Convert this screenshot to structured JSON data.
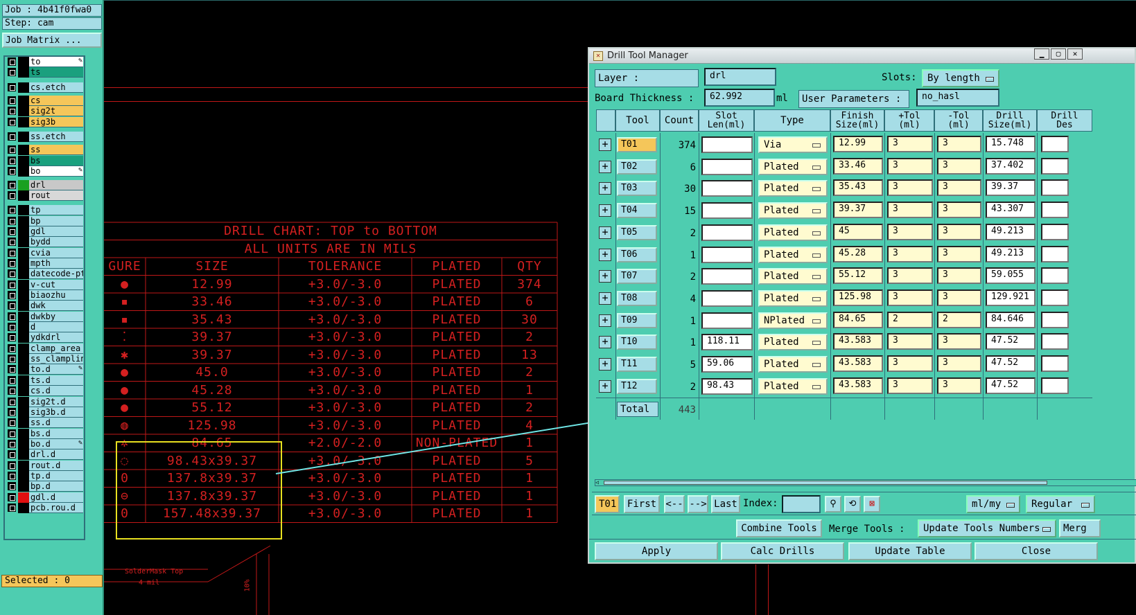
{
  "left_panel": {
    "job": "Job : 4b41f0fwa0",
    "step": "Step: cam",
    "job_matrix_btn": "Job Matrix ...",
    "selected": "Selected : 0",
    "layers": [
      {
        "name": "to",
        "bg": "#ffffff",
        "swatch": "#000000",
        "pencil": true
      },
      {
        "name": "ts",
        "bg": "#1aa07e",
        "swatch": "#000000",
        "pencil": false
      },
      {
        "name": "cs.etch",
        "bg": "#a6dde6",
        "swatch": "#000000",
        "pencil": false
      },
      {
        "name": "cs",
        "bg": "#f5c65a",
        "swatch": "#000000",
        "pencil": false
      },
      {
        "name": "sig2t",
        "bg": "#f5c65a",
        "swatch": "#000000",
        "pencil": false
      },
      {
        "name": "sig3b",
        "bg": "#f5c65a",
        "swatch": "#000000",
        "pencil": false
      },
      {
        "name": "ss.etch",
        "bg": "#a6dde6",
        "swatch": "#000000",
        "pencil": false
      },
      {
        "name": "ss",
        "bg": "#f5c65a",
        "swatch": "#000000",
        "pencil": false
      },
      {
        "name": "bs",
        "bg": "#1aa07e",
        "swatch": "#000000",
        "pencil": false
      },
      {
        "name": "bo",
        "bg": "#ffffff",
        "swatch": "#000000",
        "pencil": true
      },
      {
        "name": "drl",
        "bg": "#c8c8c8",
        "swatch": "#1aa020",
        "pencil": false
      },
      {
        "name": "rout",
        "bg": "#d8d8d8",
        "swatch": "#000000",
        "pencil": false
      },
      {
        "name": "tp",
        "bg": "#a6dde6",
        "swatch": "#000000",
        "pencil": false
      },
      {
        "name": "bp",
        "bg": "#a6dde6",
        "swatch": "#000000",
        "pencil": false
      },
      {
        "name": "gdl",
        "bg": "#a6dde6",
        "swatch": "#000000",
        "pencil": false
      },
      {
        "name": "bydd",
        "bg": "#a6dde6",
        "swatch": "#000000",
        "pencil": false
      },
      {
        "name": "cvia",
        "bg": "#a6dde6",
        "swatch": "#000000",
        "pencil": false
      },
      {
        "name": "mpth",
        "bg": "#a6dde6",
        "swatch": "#000000",
        "pencil": false
      },
      {
        "name": "datecode-pt",
        "bg": "#a6dde6",
        "swatch": "#000000",
        "pencil": false
      },
      {
        "name": "v-cut",
        "bg": "#a6dde6",
        "swatch": "#000000",
        "pencil": false
      },
      {
        "name": "biaozhu",
        "bg": "#a6dde6",
        "swatch": "#000000",
        "pencil": false
      },
      {
        "name": "dwk",
        "bg": "#a6dde6",
        "swatch": "#000000",
        "pencil": false
      },
      {
        "name": "dwkby",
        "bg": "#a6dde6",
        "swatch": "#000000",
        "pencil": false
      },
      {
        "name": "d",
        "bg": "#a6dde6",
        "swatch": "#000000",
        "pencil": false
      },
      {
        "name": "ydkdrl",
        "bg": "#a6dde6",
        "swatch": "#000000",
        "pencil": false
      },
      {
        "name": "clamp_area",
        "bg": "#a6dde6",
        "swatch": "#000000",
        "pencil": false
      },
      {
        "name": "ss_clampline",
        "bg": "#a6dde6",
        "swatch": "#000000",
        "pencil": false
      },
      {
        "name": "to.d",
        "bg": "#a6dde6",
        "swatch": "#000000",
        "pencil": true
      },
      {
        "name": "ts.d",
        "bg": "#a6dde6",
        "swatch": "#000000",
        "pencil": false
      },
      {
        "name": "cs.d",
        "bg": "#a6dde6",
        "swatch": "#000000",
        "pencil": false
      },
      {
        "name": "sig2t.d",
        "bg": "#a6dde6",
        "swatch": "#000000",
        "pencil": false
      },
      {
        "name": "sig3b.d",
        "bg": "#a6dde6",
        "swatch": "#000000",
        "pencil": false
      },
      {
        "name": "ss.d",
        "bg": "#a6dde6",
        "swatch": "#000000",
        "pencil": false
      },
      {
        "name": "bs.d",
        "bg": "#a6dde6",
        "swatch": "#000000",
        "pencil": false
      },
      {
        "name": "bo.d",
        "bg": "#a6dde6",
        "swatch": "#000000",
        "pencil": true
      },
      {
        "name": "drl.d",
        "bg": "#a6dde6",
        "swatch": "#000000",
        "pencil": false
      },
      {
        "name": "rout.d",
        "bg": "#a6dde6",
        "swatch": "#000000",
        "pencil": false
      },
      {
        "name": "tp.d",
        "bg": "#a6dde6",
        "swatch": "#000000",
        "pencil": false
      },
      {
        "name": "bp.d",
        "bg": "#a6dde6",
        "swatch": "#000000",
        "pencil": false
      },
      {
        "name": "gdl.d",
        "bg": "#a6dde6",
        "swatch": "#e01010",
        "pencil": false
      },
      {
        "name": "pcb.rou.d",
        "bg": "#a6dde6",
        "swatch": "#000000",
        "pencil": false
      }
    ]
  },
  "drill_chart": {
    "title1": "DRILL CHART: TOP to BOTTOM",
    "title2": "ALL UNITS ARE IN MILS",
    "headers": [
      "GURE",
      "SIZE",
      "TOLERANCE",
      "PLATED",
      "QTY"
    ],
    "rows": [
      {
        "fig": "●",
        "size": "12.99",
        "tol": "+3.0/-3.0",
        "plated": "PLATED",
        "qty": "374"
      },
      {
        "fig": "▪",
        "size": "33.46",
        "tol": "+3.0/-3.0",
        "plated": "PLATED",
        "qty": "6"
      },
      {
        "fig": "▪",
        "size": "35.43",
        "tol": "+3.0/-3.0",
        "plated": "PLATED",
        "qty": "30"
      },
      {
        "fig": "⁚",
        "size": "39.37",
        "tol": "+3.0/-3.0",
        "plated": "PLATED",
        "qty": "2"
      },
      {
        "fig": "✱",
        "size": "39.37",
        "tol": "+3.0/-3.0",
        "plated": "PLATED",
        "qty": "13"
      },
      {
        "fig": "●",
        "size": "45.0",
        "tol": "+3.0/-3.0",
        "plated": "PLATED",
        "qty": "2"
      },
      {
        "fig": "●",
        "size": "45.28",
        "tol": "+3.0/-3.0",
        "plated": "PLATED",
        "qty": "1"
      },
      {
        "fig": "●",
        "size": "55.12",
        "tol": "+3.0/-3.0",
        "plated": "PLATED",
        "qty": "2"
      },
      {
        "fig": "◍",
        "size": "125.98",
        "tol": "+3.0/-3.0",
        "plated": "PLATED",
        "qty": "4"
      },
      {
        "fig": "✲",
        "size": "84.65",
        "tol": "+2.0/-2.0",
        "plated": "NON-PLATED",
        "qty": "1"
      },
      {
        "fig": "◌",
        "size": "98.43x39.37",
        "tol": "+3.0/-3.0",
        "plated": "PLATED",
        "qty": "5"
      },
      {
        "fig": "0",
        "size": "137.8x39.37",
        "tol": "+3.0/-3.0",
        "plated": "PLATED",
        "qty": "1"
      },
      {
        "fig": "⊖",
        "size": "137.8x39.37",
        "tol": "+3.0/-3.0",
        "plated": "PLATED",
        "qty": "1"
      },
      {
        "fig": "0",
        "size": "157.48x39.37",
        "tol": "+3.0/-3.0",
        "plated": "PLATED",
        "qty": "1"
      }
    ],
    "bottom_texts": [
      "SolderMask Top",
      "4 mil",
      "10%"
    ]
  },
  "dtm": {
    "title": "Drill Tool Manager",
    "layer_label": "Layer              :",
    "layer_value": "drl",
    "slots_label": "Slots:",
    "slots_value": "By length",
    "board_thickness_label": "Board Thickness :",
    "board_thickness_value": "62.992",
    "board_thickness_unit": "ml",
    "user_params_label": "User Parameters :",
    "user_params_value": "no_hasl",
    "headers": {
      "tool": "Tool",
      "count": "Count",
      "slot_len_1": "Slot",
      "slot_len_2": "Len(ml)",
      "type": "Type",
      "finish_1": "Finish",
      "finish_2": "Size(ml)",
      "ptol_1": "+Tol",
      "ptol_2": "(ml)",
      "ntol_1": "-Tol",
      "ntol_2": "(ml)",
      "drill_1": "Drill",
      "drill_2": "Size(ml)",
      "drill_des_1": "Drill",
      "drill_des_2": "Des"
    },
    "rows": [
      {
        "tool": "T01",
        "count": "374",
        "slot": "",
        "type": "Via",
        "finish": "12.99",
        "ptol": "3",
        "ntol": "3",
        "drill": "15.748"
      },
      {
        "tool": "T02",
        "count": "6",
        "slot": "",
        "type": "Plated",
        "finish": "33.46",
        "ptol": "3",
        "ntol": "3",
        "drill": "37.402"
      },
      {
        "tool": "T03",
        "count": "30",
        "slot": "",
        "type": "Plated",
        "finish": "35.43",
        "ptol": "3",
        "ntol": "3",
        "drill": "39.37"
      },
      {
        "tool": "T04",
        "count": "15",
        "slot": "",
        "type": "Plated",
        "finish": "39.37",
        "ptol": "3",
        "ntol": "3",
        "drill": "43.307"
      },
      {
        "tool": "T05",
        "count": "2",
        "slot": "",
        "type": "Plated",
        "finish": "45",
        "ptol": "3",
        "ntol": "3",
        "drill": "49.213"
      },
      {
        "tool": "T06",
        "count": "1",
        "slot": "",
        "type": "Plated",
        "finish": "45.28",
        "ptol": "3",
        "ntol": "3",
        "drill": "49.213"
      },
      {
        "tool": "T07",
        "count": "2",
        "slot": "",
        "type": "Plated",
        "finish": "55.12",
        "ptol": "3",
        "ntol": "3",
        "drill": "59.055"
      },
      {
        "tool": "T08",
        "count": "4",
        "slot": "",
        "type": "Plated",
        "finish": "125.98",
        "ptol": "3",
        "ntol": "3",
        "drill": "129.921"
      },
      {
        "tool": "T09",
        "count": "1",
        "slot": "",
        "type": "NPlated",
        "finish": "84.65",
        "ptol": "2",
        "ntol": "2",
        "drill": "84.646"
      },
      {
        "tool": "T10",
        "count": "1",
        "slot": "118.11",
        "type": "Plated",
        "finish": "43.583",
        "ptol": "3",
        "ntol": "3",
        "drill": "47.52"
      },
      {
        "tool": "T11",
        "count": "5",
        "slot": "59.06",
        "type": "Plated",
        "finish": "43.583",
        "ptol": "3",
        "ntol": "3",
        "drill": "47.52"
      },
      {
        "tool": "T12",
        "count": "2",
        "slot": "98.43",
        "type": "Plated",
        "finish": "43.583",
        "ptol": "3",
        "ntol": "3",
        "drill": "47.52"
      }
    ],
    "total_label": "Total",
    "total_value": "443",
    "current_tool": "T01",
    "first_btn": "First",
    "prev_btn": "<--",
    "next_btn": "-->",
    "last_btn": "Last",
    "index_label": "Index:",
    "units_value": "ml/my",
    "mode_value": "Regular",
    "combine_btn": "Combine Tools",
    "merge_label": "Merge Tools :",
    "update_numbers_value": "Update Tools Numbers",
    "merge_cut": "Merg",
    "apply_btn": "Apply",
    "calc_btn": "Calc Drills",
    "update_table_btn": "Update Table",
    "close_btn": "Close"
  }
}
